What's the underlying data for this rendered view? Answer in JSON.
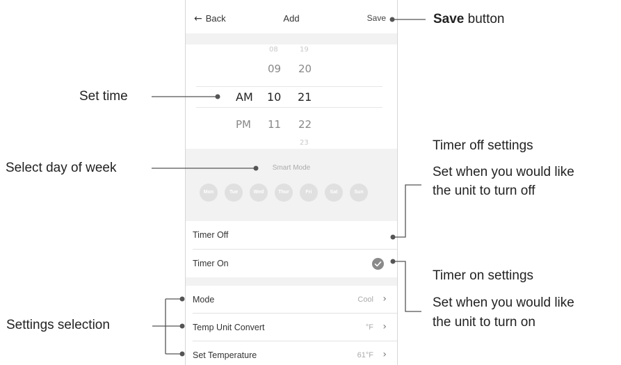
{
  "phone": {
    "header": {
      "back_label": "Back",
      "title": "Add",
      "save_label": "Save"
    },
    "time_picker": {
      "faint_top": [
        "08",
        "19"
      ],
      "rows": [
        {
          "period": "",
          "hour": "09",
          "minute": "20"
        },
        {
          "period": "AM",
          "hour": "10",
          "minute": "21"
        },
        {
          "period": "PM",
          "hour": "11",
          "minute": "22"
        }
      ],
      "faint_bottom": "23"
    },
    "smart_mode_label": "Smart Mode",
    "days": [
      "Mon",
      "Tue",
      "Wed",
      "Thur",
      "Fri",
      "Sat",
      "Sun"
    ],
    "timer_off_label": "Timer Off",
    "timer_on_label": "Timer On",
    "settings": [
      {
        "label": "Mode",
        "value": "Cool"
      },
      {
        "label": "Temp Unit Convert",
        "value": "°F"
      },
      {
        "label": "Set Temperature",
        "value": "61°F"
      }
    ]
  },
  "annotations": {
    "save_bold": "Save",
    "save_rest": " button",
    "set_time": "Set time",
    "select_day": "Select day of week",
    "settings_selection": "Settings selection",
    "timer_off_title": "Timer off settings",
    "timer_off_line1": "Set when you would like",
    "timer_off_line2": "the unit to turn off",
    "timer_on_title": "Timer on settings",
    "timer_on_line1": "Set when you would like",
    "timer_on_line2": "the unit to turn on"
  },
  "colors": {
    "line": "#555555",
    "dot": "#555555",
    "check": "#8a8a8a",
    "panel": "#f2f2f2"
  }
}
